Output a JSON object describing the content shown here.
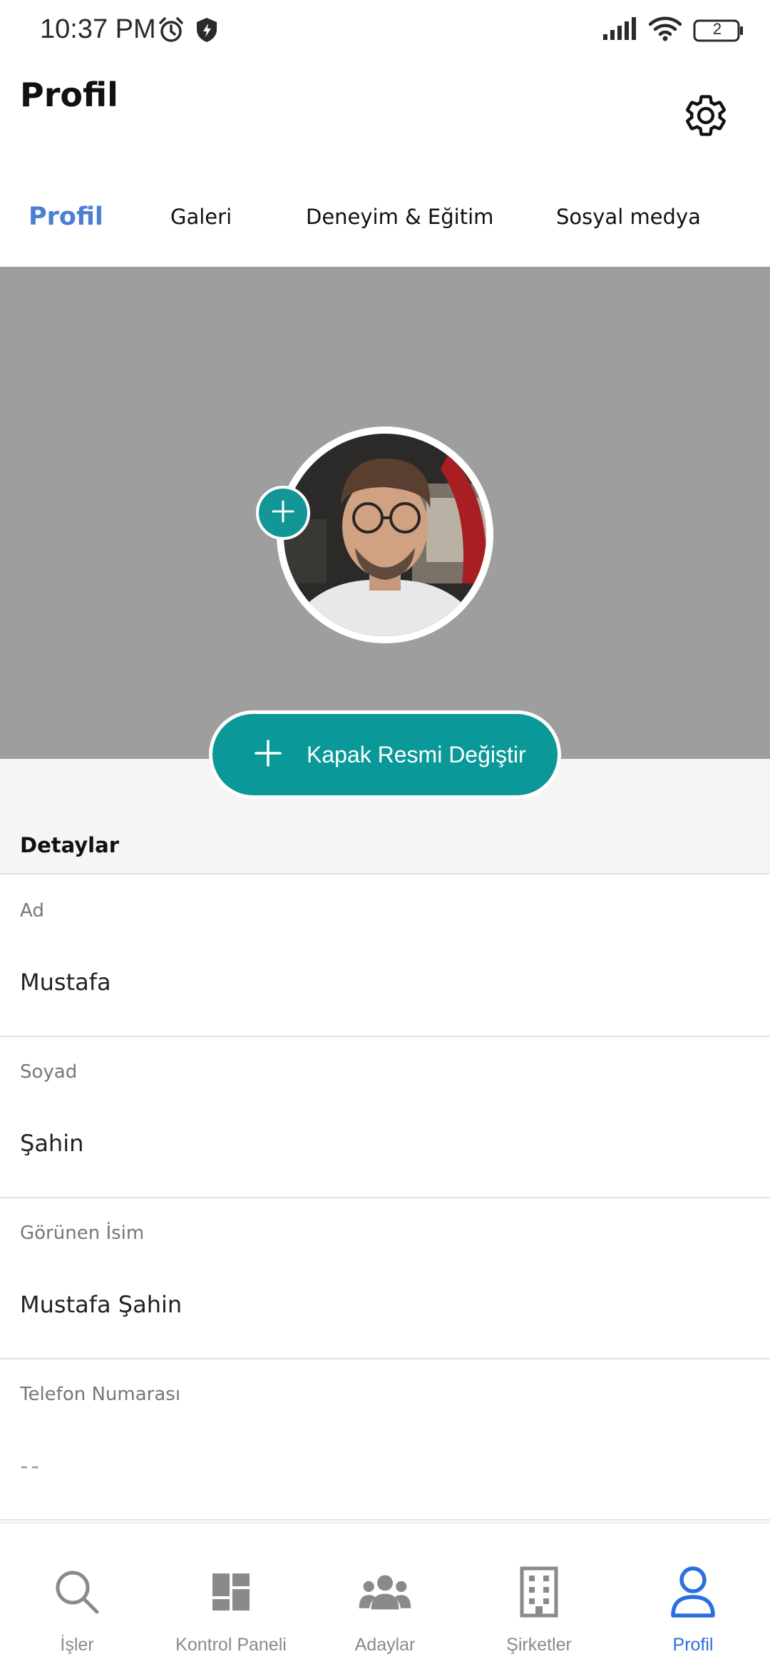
{
  "status_bar": {
    "time": "10:37 PM",
    "battery_level": "2",
    "icons": [
      "alarm-icon",
      "shield-icon",
      "signal-icon",
      "wifi-icon",
      "battery-icon"
    ]
  },
  "header": {
    "title": "Profil",
    "settings_icon": "gear-icon"
  },
  "tabs": [
    {
      "label": "Profil",
      "active": true
    },
    {
      "label": "Galeri",
      "active": false
    },
    {
      "label": "Deneyim & Eğitim",
      "active": false
    },
    {
      "label": "Sosyal medya",
      "active": false
    }
  ],
  "cover": {
    "change_cover_label": "Kapak Resmi Değiştir",
    "avatar_add_icon": "plus-icon"
  },
  "details": {
    "title": "Detaylar",
    "fields": [
      {
        "label": "Ad",
        "value": "Mustafa"
      },
      {
        "label": "Soyad",
        "value": "Şahin"
      },
      {
        "label": "Görünen İsim",
        "value": "Mustafa Şahin"
      },
      {
        "label": "Telefon Numarası",
        "value": "--"
      }
    ]
  },
  "bottom_nav": [
    {
      "label": "İşler",
      "icon": "search-icon",
      "active": false
    },
    {
      "label": "Kontrol Paneli",
      "icon": "dashboard-icon",
      "active": false
    },
    {
      "label": "Adaylar",
      "icon": "people-icon",
      "active": false
    },
    {
      "label": "Şirketler",
      "icon": "building-icon",
      "active": false
    },
    {
      "label": "Profil",
      "icon": "person-icon",
      "active": true
    }
  ],
  "colors": {
    "accent_teal": "#0a9898",
    "active_tab": "#4a7fd4",
    "nav_active": "#2a6fe0",
    "cover_gray": "#9e9e9e"
  }
}
